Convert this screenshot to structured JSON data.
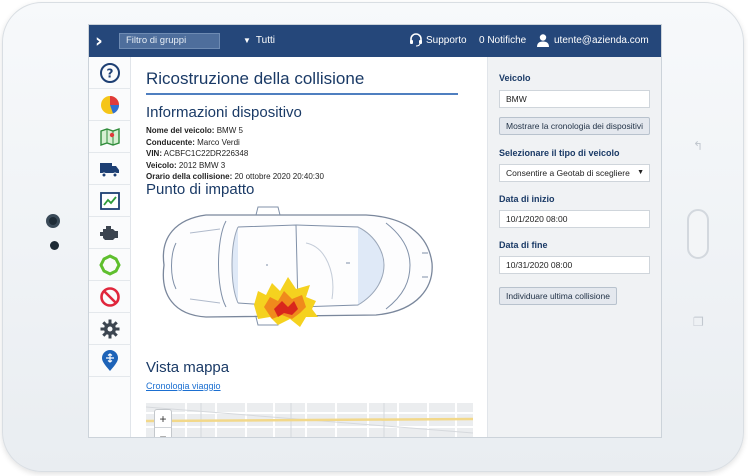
{
  "topbar": {
    "group_filter_placeholder": "Filtro di gruppi",
    "all_label": "Tutti",
    "support_label": "Supporto",
    "notifications_label": "0 Notifiche",
    "user_label": "utente@azienda.com"
  },
  "sidebar": {
    "items": [
      {
        "icon": "help-icon"
      },
      {
        "icon": "pie-chart-icon"
      },
      {
        "icon": "map-icon"
      },
      {
        "icon": "truck-icon"
      },
      {
        "icon": "trend-chart-icon"
      },
      {
        "icon": "engine-icon"
      },
      {
        "icon": "zones-icon"
      },
      {
        "icon": "rules-prohibited-icon"
      },
      {
        "icon": "gear-icon"
      },
      {
        "icon": "marketplace-pin-icon"
      }
    ]
  },
  "main": {
    "title": "Ricostruzione della collisione",
    "device_info_title": "Informazioni dispositivo",
    "info": [
      {
        "label": "Nome del veicolo:",
        "value": "BMW 5"
      },
      {
        "label": "Conducente:",
        "value": "Marco Verdi"
      },
      {
        "label": "VIN:",
        "value": "ACBFC1C22DR226348"
      },
      {
        "label": "Veicolo:",
        "value": "2012 BMW 3"
      },
      {
        "label": "Orario della collisione:",
        "value": "20 ottobre 2020 20:40:30"
      }
    ],
    "impact_title": "Punto di impatto",
    "map_title": "Vista mappa",
    "trip_history_link": "Cronologia viaggio",
    "map_zoom_in": "+",
    "map_zoom_out": "−"
  },
  "panel": {
    "vehicle_label": "Veicolo",
    "vehicle_value": "BMW",
    "device_history_button": "Mostrare la cronologia dei dispositivi",
    "vehicle_type_label": "Selezionare il tipo di veicolo",
    "vehicle_type_value": "Consentire a Geotab di scegliere",
    "start_date_label": "Data di inizio",
    "start_date_value": "10/1/2020 08:00",
    "end_date_label": "Data di fine",
    "end_date_value": "10/31/2020 08:00",
    "locate_button": "Individuare ultima collisione"
  },
  "colors": {
    "topbar": "#25477a",
    "title": "#1a3a66",
    "link": "#1b6fd1",
    "impact_outer": "#f5d21f",
    "impact_mid": "#f08a1c",
    "impact_inner": "#d9261c"
  }
}
